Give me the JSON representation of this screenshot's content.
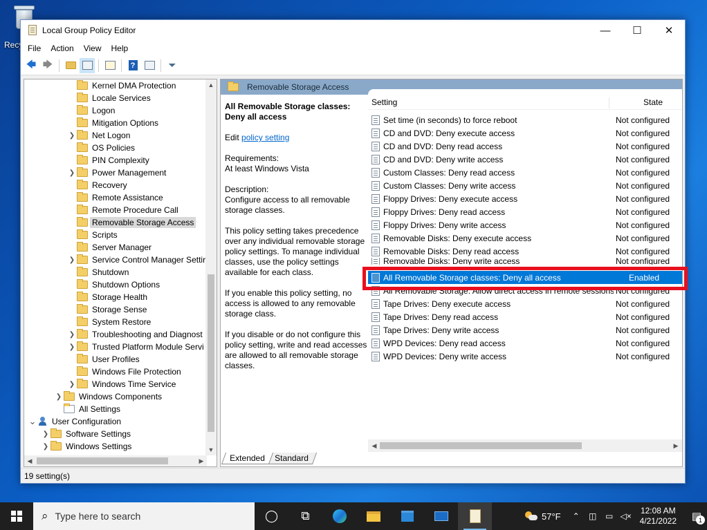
{
  "desktop": {
    "recycle_bin_label": "Recy"
  },
  "window": {
    "title": "Local Group Policy Editor",
    "controls": {
      "minimize": "—",
      "maximize": "☐",
      "close": "✕"
    }
  },
  "menu": [
    "File",
    "Action",
    "View",
    "Help"
  ],
  "tree": {
    "items": [
      {
        "label": "Kernel DMA Protection",
        "expandable": false,
        "selected": false
      },
      {
        "label": "Locale Services",
        "expandable": false,
        "selected": false
      },
      {
        "label": "Logon",
        "expandable": false,
        "selected": false
      },
      {
        "label": "Mitigation Options",
        "expandable": false,
        "selected": false
      },
      {
        "label": "Net Logon",
        "expandable": true,
        "selected": false
      },
      {
        "label": "OS Policies",
        "expandable": false,
        "selected": false
      },
      {
        "label": "PIN Complexity",
        "expandable": false,
        "selected": false
      },
      {
        "label": "Power Management",
        "expandable": true,
        "selected": false
      },
      {
        "label": "Recovery",
        "expandable": false,
        "selected": false
      },
      {
        "label": "Remote Assistance",
        "expandable": false,
        "selected": false
      },
      {
        "label": "Remote Procedure Call",
        "expandable": false,
        "selected": false
      },
      {
        "label": "Removable Storage Access",
        "expandable": false,
        "selected": true
      },
      {
        "label": "Scripts",
        "expandable": false,
        "selected": false
      },
      {
        "label": "Server Manager",
        "expandable": false,
        "selected": false
      },
      {
        "label": "Service Control Manager Settir",
        "expandable": true,
        "selected": false
      },
      {
        "label": "Shutdown",
        "expandable": false,
        "selected": false
      },
      {
        "label": "Shutdown Options",
        "expandable": false,
        "selected": false
      },
      {
        "label": "Storage Health",
        "expandable": false,
        "selected": false
      },
      {
        "label": "Storage Sense",
        "expandable": false,
        "selected": false
      },
      {
        "label": "System Restore",
        "expandable": false,
        "selected": false
      },
      {
        "label": "Troubleshooting and Diagnost",
        "expandable": true,
        "selected": false
      },
      {
        "label": "Trusted Platform Module Servi",
        "expandable": true,
        "selected": false
      },
      {
        "label": "User Profiles",
        "expandable": false,
        "selected": false
      },
      {
        "label": "Windows File Protection",
        "expandable": false,
        "selected": false
      },
      {
        "label": "Windows Time Service",
        "expandable": true,
        "selected": false
      }
    ],
    "windows_components": "Windows Components",
    "all_settings": "All Settings",
    "user_configuration": "User Configuration",
    "software_settings": "Software Settings",
    "windows_settings": "Windows Settings"
  },
  "details": {
    "header": "Removable Storage Access",
    "policy_title": "All Removable Storage classes: Deny all access",
    "edit_prefix": "Edit ",
    "edit_link": "policy setting ",
    "requirements_label": "Requirements:",
    "requirements_value": "At least Windows Vista",
    "description_label": "Description:",
    "description_1": "Configure access to all removable storage classes.",
    "description_2": "This policy setting takes precedence over any individual removable storage policy settings. To manage individual classes, use the policy settings available for each class.",
    "description_3": "If you enable this policy setting, no access is allowed to any removable storage class.",
    "description_4": "If you disable or do not configure this policy setting, write and read accesses are allowed to all removable storage classes."
  },
  "list": {
    "col_setting": "Setting",
    "col_state": "State",
    "rows": [
      {
        "name": "Set time (in seconds) to force reboot",
        "state": "Not configured"
      },
      {
        "name": "CD and DVD: Deny execute access",
        "state": "Not configured"
      },
      {
        "name": "CD and DVD: Deny read access",
        "state": "Not configured"
      },
      {
        "name": "CD and DVD: Deny write access",
        "state": "Not configured"
      },
      {
        "name": "Custom Classes: Deny read access",
        "state": "Not configured"
      },
      {
        "name": "Custom Classes: Deny write access",
        "state": "Not configured"
      },
      {
        "name": "Floppy Drives: Deny execute access",
        "state": "Not configured"
      },
      {
        "name": "Floppy Drives: Deny read access",
        "state": "Not configured"
      },
      {
        "name": "Floppy Drives: Deny write access",
        "state": "Not configured"
      },
      {
        "name": "Removable Disks: Deny execute access",
        "state": "Not configured"
      },
      {
        "name": "Removable Disks: Deny read access",
        "state": "Not configured"
      },
      {
        "name": "Removable Disks: Deny write access",
        "state": "Not configured"
      },
      {
        "name": "All Removable Storage classes: Deny all access",
        "state": "Enabled"
      },
      {
        "name": "All Removable Storage: Allow direct access in remote sessions",
        "state": "Not configured"
      },
      {
        "name": "Tape Drives: Deny execute access",
        "state": "Not configured"
      },
      {
        "name": "Tape Drives: Deny read access",
        "state": "Not configured"
      },
      {
        "name": "Tape Drives: Deny write access",
        "state": "Not configured"
      },
      {
        "name": "WPD Devices: Deny read access",
        "state": "Not configured"
      },
      {
        "name": "WPD Devices: Deny write access",
        "state": "Not configured"
      }
    ]
  },
  "tabs": [
    "Extended",
    "Standard"
  ],
  "status": "19 setting(s)",
  "taskbar": {
    "search_placeholder": "Type here to search",
    "weather": "57°F",
    "time": "12:08 AM",
    "date": "4/21/2022",
    "notifications": "1"
  },
  "colors": {
    "selection": "#0078d7",
    "highlight_box": "#e8101e",
    "header_bar": "#8aa9c9"
  }
}
